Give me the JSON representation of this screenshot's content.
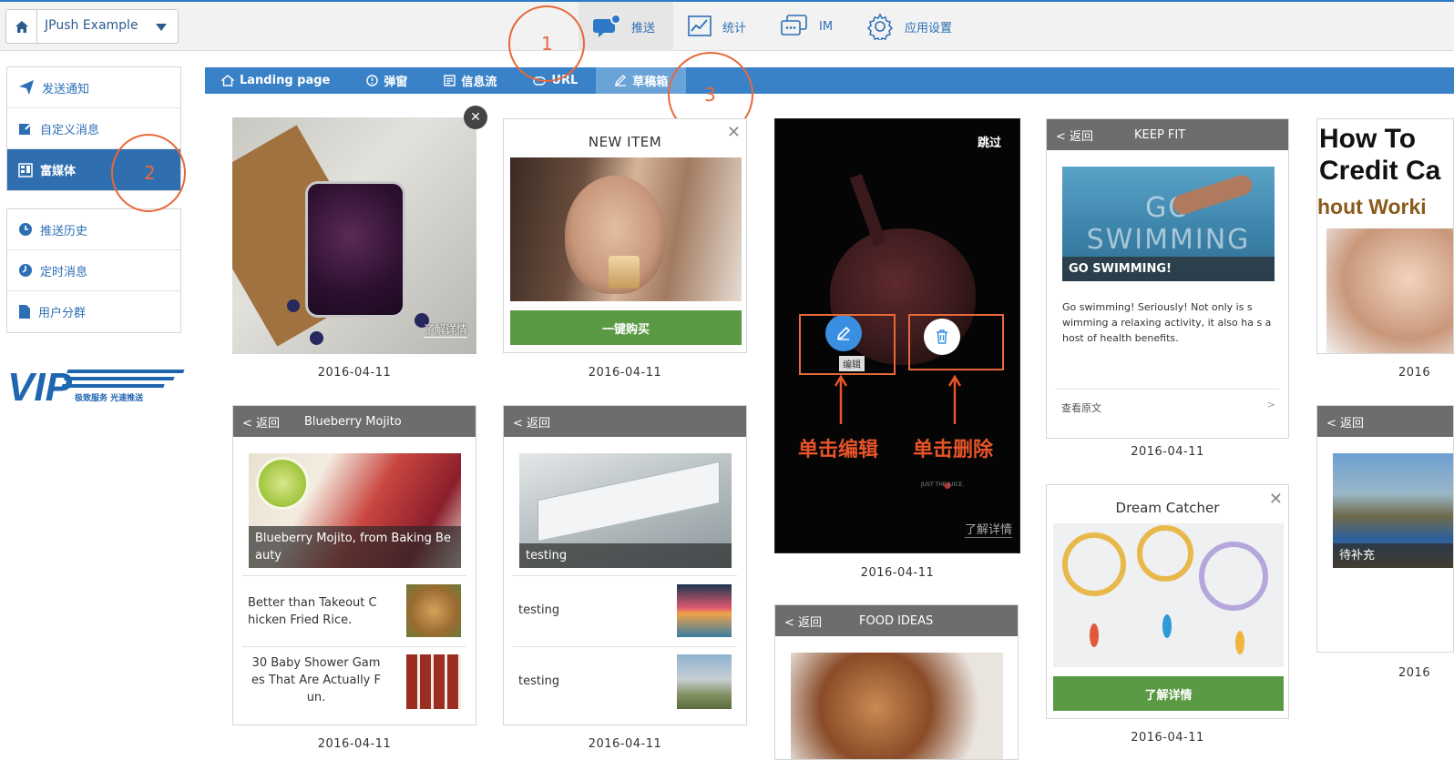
{
  "app": {
    "name": "JPush Example"
  },
  "topnav": [
    {
      "label": "推送"
    },
    {
      "label": "统计"
    },
    {
      "label": "IM"
    },
    {
      "label": "应用设置"
    }
  ],
  "sidebar": {
    "group1": [
      {
        "label": "发送通知"
      },
      {
        "label": "自定义消息"
      },
      {
        "label": "富媒体"
      }
    ],
    "group2": [
      {
        "label": "推送历史"
      },
      {
        "label": "定时消息"
      },
      {
        "label": "用户分群"
      }
    ],
    "logo": {
      "text": "VIP",
      "tagline": "极致服务 光速推送"
    }
  },
  "tabs": [
    {
      "label": "Landing page"
    },
    {
      "label": "弹窗"
    },
    {
      "label": "信息流"
    },
    {
      "label": "URL"
    },
    {
      "label": "草稿箱"
    }
  ],
  "annotations": [
    "1",
    "2",
    "3"
  ],
  "cards": {
    "jam": {
      "link": "了解详情",
      "date": "2016-04-11"
    },
    "newitem": {
      "title": "NEW ITEM",
      "button": "一键购买",
      "date": "2016-04-11"
    },
    "splash": {
      "skip": "跳过",
      "tooltip": "编辑",
      "edit_hint": "单击编辑",
      "delete_hint": "单击删除",
      "link": "了解详情",
      "brand_small": "JUST THE JUICE.",
      "date": "2016-04-11"
    },
    "keepfit": {
      "back": "< 返回",
      "title": "KEEP FIT",
      "image_title": "GO SWIMMING",
      "caption": "GO SWIMMING!",
      "body": "Go swimming! Seriously! Not only is s wimming a relaxing activity, it also ha s a host of health benefits.",
      "more": "查看原文",
      "chev": ">",
      "date": "2016-04-11"
    },
    "credit": {
      "line1": "How To",
      "line2": "Credit Ca",
      "line3": "hout Worki",
      "date": "2016"
    },
    "mojito": {
      "back": "< 返回",
      "title": "Blueberry Mojito",
      "caption": "Blueberry Mojito, from Baking Be auty",
      "item1": "Better than Takeout C hicken Fried Rice.",
      "item2": "30 Baby Shower Gam es That Are Actually F un.",
      "date": "2016-04-11"
    },
    "testing": {
      "back": "< 返回",
      "caption": "testing",
      "item1": "testing",
      "item2": "testing",
      "date": "2016-04-11"
    },
    "dream": {
      "title": "Dream Catcher",
      "button": "了解详情",
      "date": "2016-04-11"
    },
    "food": {
      "back": "< 返回",
      "title": "FOOD IDEAS"
    },
    "lake": {
      "back": "< 返回",
      "caption": "待补充",
      "date": "2016"
    }
  },
  "colors": {
    "brand_blue": "#2d6fb5",
    "tab_bar": "#3a82c8",
    "green": "#5b9a45",
    "annotation": "#e8683a"
  }
}
